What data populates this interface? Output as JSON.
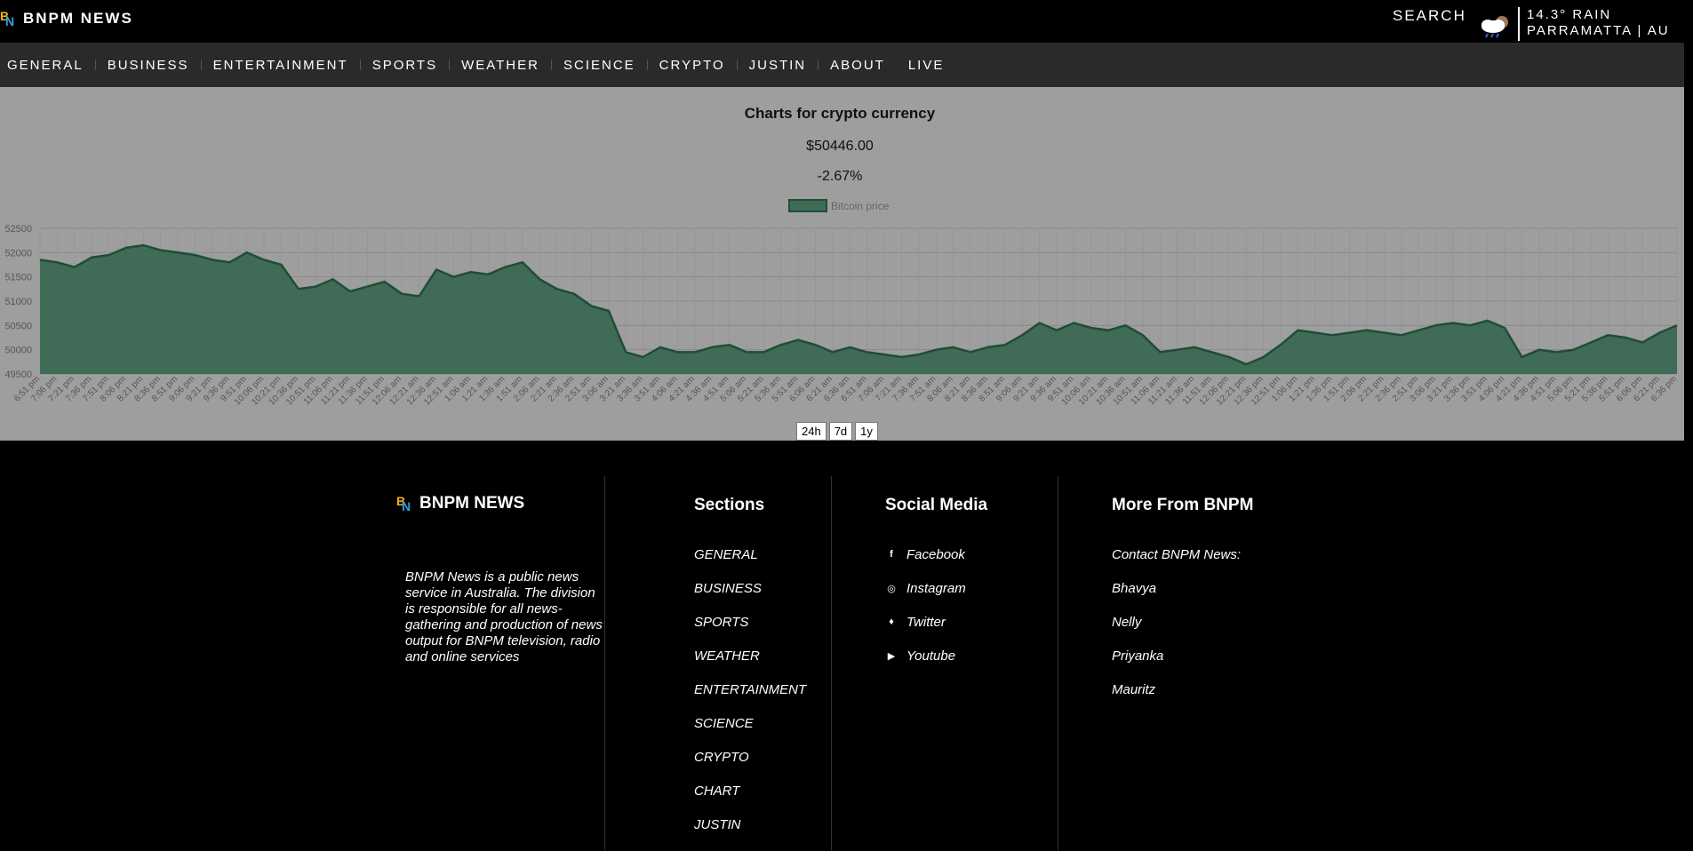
{
  "header": {
    "brand": "BNPM NEWS",
    "logo_letters": [
      "B",
      "N"
    ],
    "search_label": "SEARCH",
    "weather_line1": "14.3° RAIN",
    "weather_line2": "PARRAMATTA | AU"
  },
  "nav": {
    "items": [
      "GENERAL",
      "BUSINESS",
      "ENTERTAINMENT",
      "SPORTS",
      "WEATHER",
      "SCIENCE",
      "CRYPTO",
      "JUSTIN",
      "ABOUT",
      "LIVE"
    ]
  },
  "chart": {
    "title": "Charts for crypto currency",
    "price": "$50446.00",
    "change": "-2.67%",
    "range_buttons": [
      "24h",
      "7d",
      "1y"
    ]
  },
  "chart_data": {
    "type": "area",
    "legend": "Bitcoin price",
    "legend_position": "top-center",
    "grid": true,
    "ylim": [
      49500,
      52500
    ],
    "yticks": [
      49500,
      50000,
      50500,
      51000,
      51500,
      52000,
      52500
    ],
    "fill_color": "#3f6b57",
    "line_color": "#1f4d36",
    "x": [
      "6:51 pm",
      "7:06 pm",
      "7:21 pm",
      "7:36 pm",
      "7:51 pm",
      "8:06 pm",
      "8:21 pm",
      "8:36 pm",
      "8:51 pm",
      "9:06 pm",
      "9:21 pm",
      "9:36 pm",
      "9:51 pm",
      "10:06 pm",
      "10:21 pm",
      "10:36 pm",
      "10:51 pm",
      "11:06 pm",
      "11:21 pm",
      "11:36 pm",
      "11:51 pm",
      "12:06 am",
      "12:21 am",
      "12:36 am",
      "12:51 am",
      "1:06 am",
      "1:21 am",
      "1:36 am",
      "1:51 am",
      "2:06 am",
      "2:21 am",
      "2:36 am",
      "2:51 am",
      "3:06 am",
      "3:21 am",
      "3:36 am",
      "3:51 am",
      "4:06 am",
      "4:21 am",
      "4:36 am",
      "4:51 am",
      "5:06 am",
      "5:21 am",
      "5:36 am",
      "5:51 am",
      "6:06 am",
      "6:21 am",
      "6:36 am",
      "6:51 am",
      "7:06 am",
      "7:21 am",
      "7:36 am",
      "7:51 am",
      "8:06 am",
      "8:21 am",
      "8:36 am",
      "8:51 am",
      "9:06 am",
      "9:21 am",
      "9:36 am",
      "9:51 am",
      "10:06 am",
      "10:21 am",
      "10:36 am",
      "10:51 am",
      "11:06 am",
      "11:21 am",
      "11:36 am",
      "11:51 am",
      "12:06 pm",
      "12:21 pm",
      "12:36 pm",
      "12:51 pm",
      "1:06 pm",
      "1:21 pm",
      "1:36 pm",
      "1:51 pm",
      "2:06 pm",
      "2:21 pm",
      "2:36 pm",
      "2:51 pm",
      "3:06 pm",
      "3:21 pm",
      "3:36 pm",
      "3:51 pm",
      "4:06 pm",
      "4:21 pm",
      "4:36 pm",
      "4:51 pm",
      "5:06 pm",
      "5:21 pm",
      "5:36 pm",
      "5:51 pm",
      "6:06 pm",
      "6:21 pm",
      "6:36 pm"
    ],
    "values": [
      51850,
      51800,
      51700,
      51900,
      51950,
      52100,
      52150,
      52050,
      52000,
      51950,
      51850,
      51800,
      52000,
      51850,
      51750,
      51250,
      51300,
      51450,
      51200,
      51300,
      51400,
      51150,
      51100,
      51650,
      51500,
      51600,
      51550,
      51700,
      51800,
      51450,
      51250,
      51150,
      50900,
      50800,
      49950,
      49850,
      50050,
      49950,
      49950,
      50050,
      50100,
      49950,
      49950,
      50100,
      50200,
      50100,
      49950,
      50050,
      49950,
      49900,
      49850,
      49900,
      50000,
      50050,
      49950,
      50050,
      50100,
      50300,
      50550,
      50400,
      50550,
      50450,
      50400,
      50500,
      50300,
      49950,
      50000,
      50050,
      49950,
      49850,
      49700,
      49850,
      50100,
      50400,
      50350,
      50300,
      50350,
      50400,
      50350,
      50300,
      50400,
      50500,
      50550,
      50500,
      50600,
      50450,
      49850,
      50000,
      49950,
      50000,
      50150,
      50300,
      50250,
      50150,
      50350,
      50500
    ]
  },
  "footer": {
    "brand": "BNPM NEWS",
    "description": "BNPM News is a public news service in Australia. The division is responsible for all news-gathering and production of news output for BNPM television, radio and online services",
    "sections_heading": "Sections",
    "sections": [
      "GENERAL",
      "BUSINESS",
      "SPORTS",
      "WEATHER",
      "ENTERTAINMENT",
      "SCIENCE",
      "CRYPTO",
      "CHART",
      "JUSTIN"
    ],
    "social_heading": "Social Media",
    "social": [
      {
        "label": "Facebook",
        "icon": "facebook-icon",
        "glyph": "f"
      },
      {
        "label": "Instagram",
        "icon": "instagram-icon",
        "glyph": "◎"
      },
      {
        "label": "Twitter",
        "icon": "twitter-icon",
        "glyph": "♦"
      },
      {
        "label": "Youtube",
        "icon": "youtube-icon",
        "glyph": "▶"
      }
    ],
    "more_heading": "More From BNPM",
    "more": [
      "Contact BNPM News:",
      "Bhavya",
      "Nelly",
      "Priyanka",
      "Mauritz"
    ]
  }
}
